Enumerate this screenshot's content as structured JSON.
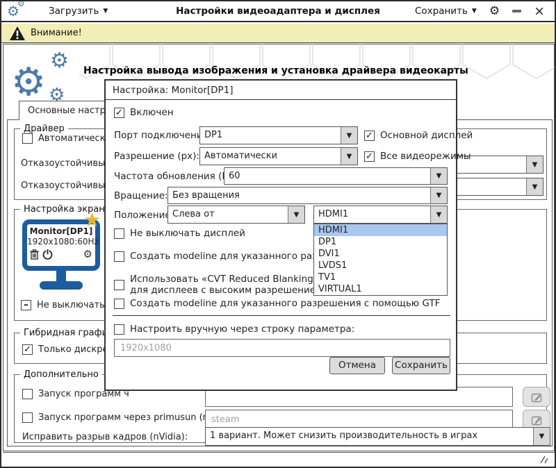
{
  "icons": {
    "gear": "⚙",
    "caret": "▼",
    "close": "×",
    "star": "★",
    "check": "✓",
    "indeterminate": "–"
  },
  "colors": {
    "accent_blue": "#4b7bab",
    "monitor_blue": "#1d5c9e",
    "star_gold": "#e7b52b",
    "warning_bg": "#f2eeb5",
    "selection_bg": "#a9c8ef"
  },
  "titlebar": {
    "load_label": "Загрузить",
    "title": "Настройки видеоадаптера и дисплея",
    "save_label": "Сохранить"
  },
  "warning": {
    "label": "Внимание!"
  },
  "main": {
    "heading": "Настройка вывода изображения и установка драйвера видеокарты",
    "tab": "Основные настройки",
    "driver_group": {
      "legend": "Драйвер",
      "auto_checkbox": "Автоматический в",
      "failsafe1": "Отказоустойчивый др",
      "failsafe2": "Отказоустойчивый др"
    },
    "screen_group": {
      "legend": "Настройка экрана",
      "monitor_name": "Monitor[DP1]",
      "monitor_mode": "1920x1080:60Hz",
      "keep_on_checkbox": "Не выключать ди"
    },
    "hybrid_group": {
      "legend": "Гибридная графика",
      "discrete_checkbox": "Только дискретно"
    },
    "extra_group": {
      "legend": "Дополнительно",
      "run1_label": "Запуск программ ч",
      "run2_label": "Запуск программ через primusun (nVidia):",
      "run2_placeholder": "steam",
      "tear_label": "Исправить разрыв кадров (nVidia):",
      "tear_value": "1 вариант. Может снизить производительность в играх"
    }
  },
  "dialog": {
    "title": "Настройка: Monitor[DP1]",
    "enabled_checkbox": "Включен",
    "port_label": "Порт подключения:",
    "port_value": "DP1",
    "primary_checkbox": "Основной дисплей",
    "resolution_label": "Разрешение (px):",
    "resolution_value": "Автоматически",
    "all_modes_checkbox": "Все видеорежимы",
    "refresh_label": "Частота обновления (Hz):",
    "refresh_value": "60",
    "rotation_label": "Вращение:",
    "rotation_value": "Без вращения",
    "position_label": "Положение:",
    "position_value": "Слева от",
    "relative_value": "HDMI1",
    "relative_options": [
      "HDMI1",
      "DP1",
      "DVI1",
      "LVDS1",
      "TV1",
      "VIRTUAL1"
    ],
    "relative_selected_index": 0,
    "keep_display_checkbox": "Не выключать дисплей",
    "modeline_checkbox": "Создать modeline для указанного разрешения",
    "cvt_checkbox_line1": "Использовать «CVT Reduced Blanking» умен",
    "cvt_checkbox_line2": "для дисплеев с высоким разрешением",
    "gtf_checkbox": "Создать modeline для указанного разрешения с помощью GTF",
    "manual_checkbox": "Настроить вручную через строку параметра:",
    "manual_placeholder": "1920x1080",
    "cancel_button": "Отмена",
    "save_button": "Сохранить"
  }
}
